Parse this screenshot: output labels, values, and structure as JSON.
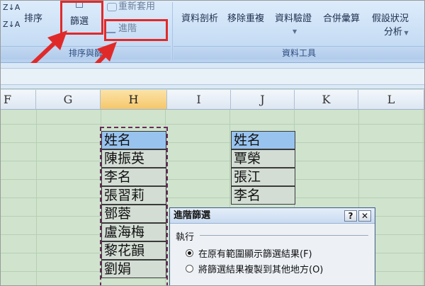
{
  "ribbon": {
    "sort_label": "排序",
    "filter_label": "篩選",
    "reapply_label": "重新套用",
    "advanced_label": "進階",
    "sort_filter_group": "排序與篩",
    "text_to_columns": "資料剖析",
    "remove_duplicates": "移除重複",
    "data_validation": "資料驗證",
    "consolidate": "合併彙算",
    "what_if_line1": "假設狀況",
    "what_if_line2": "分析",
    "data_tools_group": "資料工具"
  },
  "columns": [
    "F",
    "G",
    "H",
    "I",
    "J",
    "K",
    "L"
  ],
  "list_h": [
    "姓名",
    "陳振英",
    "李名",
    "張習莉",
    "鄧蓉",
    "盧海梅",
    "黎花韻",
    "劉娟"
  ],
  "list_j": [
    "姓名",
    "覃榮",
    "張江",
    "李名"
  ],
  "dialog": {
    "title": "進階篩選",
    "help": "?",
    "close": "✕",
    "section": "執行",
    "option1": "在原有範圍顯示篩選結果(F)",
    "option2": "將篩選結果複製到其他地方(O)"
  },
  "colors": {
    "callout": "#e02a2a",
    "header_cell": "#99c3ef",
    "selected_column": "#f5c76a"
  }
}
